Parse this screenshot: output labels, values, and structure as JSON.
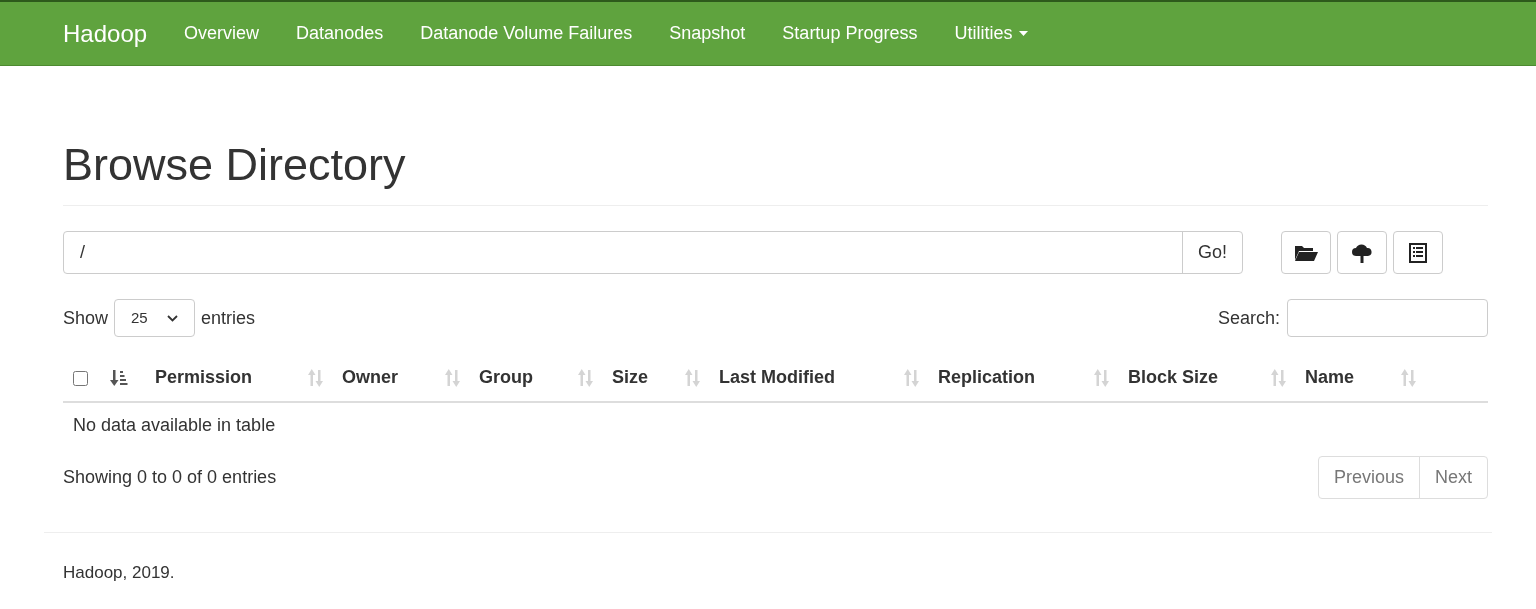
{
  "navbar": {
    "brand": "Hadoop",
    "items": [
      {
        "label": "Overview",
        "kind": "link"
      },
      {
        "label": "Datanodes",
        "kind": "link"
      },
      {
        "label": "Datanode Volume Failures",
        "kind": "link"
      },
      {
        "label": "Snapshot",
        "kind": "link"
      },
      {
        "label": "Startup Progress",
        "kind": "link"
      },
      {
        "label": "Utilities",
        "kind": "dropdown"
      }
    ]
  },
  "page_title": "Browse Directory",
  "path_field": {
    "value": "/",
    "button": "Go!"
  },
  "length_control": {
    "prefix": "Show",
    "value": "25",
    "suffix": "entries"
  },
  "search": {
    "label": "Search:"
  },
  "table": {
    "select_all_checked": false,
    "columns": [
      {
        "sorted": true
      },
      {
        "label": "Permission",
        "sorted": false
      },
      {
        "label": "Owner",
        "sorted": false
      },
      {
        "label": "Group",
        "sorted": false
      },
      {
        "label": "Size",
        "sorted": false
      },
      {
        "label": "Last Modified",
        "sorted": false
      },
      {
        "label": "Replication",
        "sorted": false
      },
      {
        "label": "Block Size",
        "sorted": false
      },
      {
        "label": "Name",
        "sorted": false
      }
    ],
    "empty_message": "No data available in table"
  },
  "info": "Showing 0 to 0 of 0 entries",
  "pagination": [
    {
      "label": "Previous",
      "disabled": true
    },
    {
      "label": "Next",
      "disabled": true
    }
  ],
  "footer": "Hadoop, 2019."
}
